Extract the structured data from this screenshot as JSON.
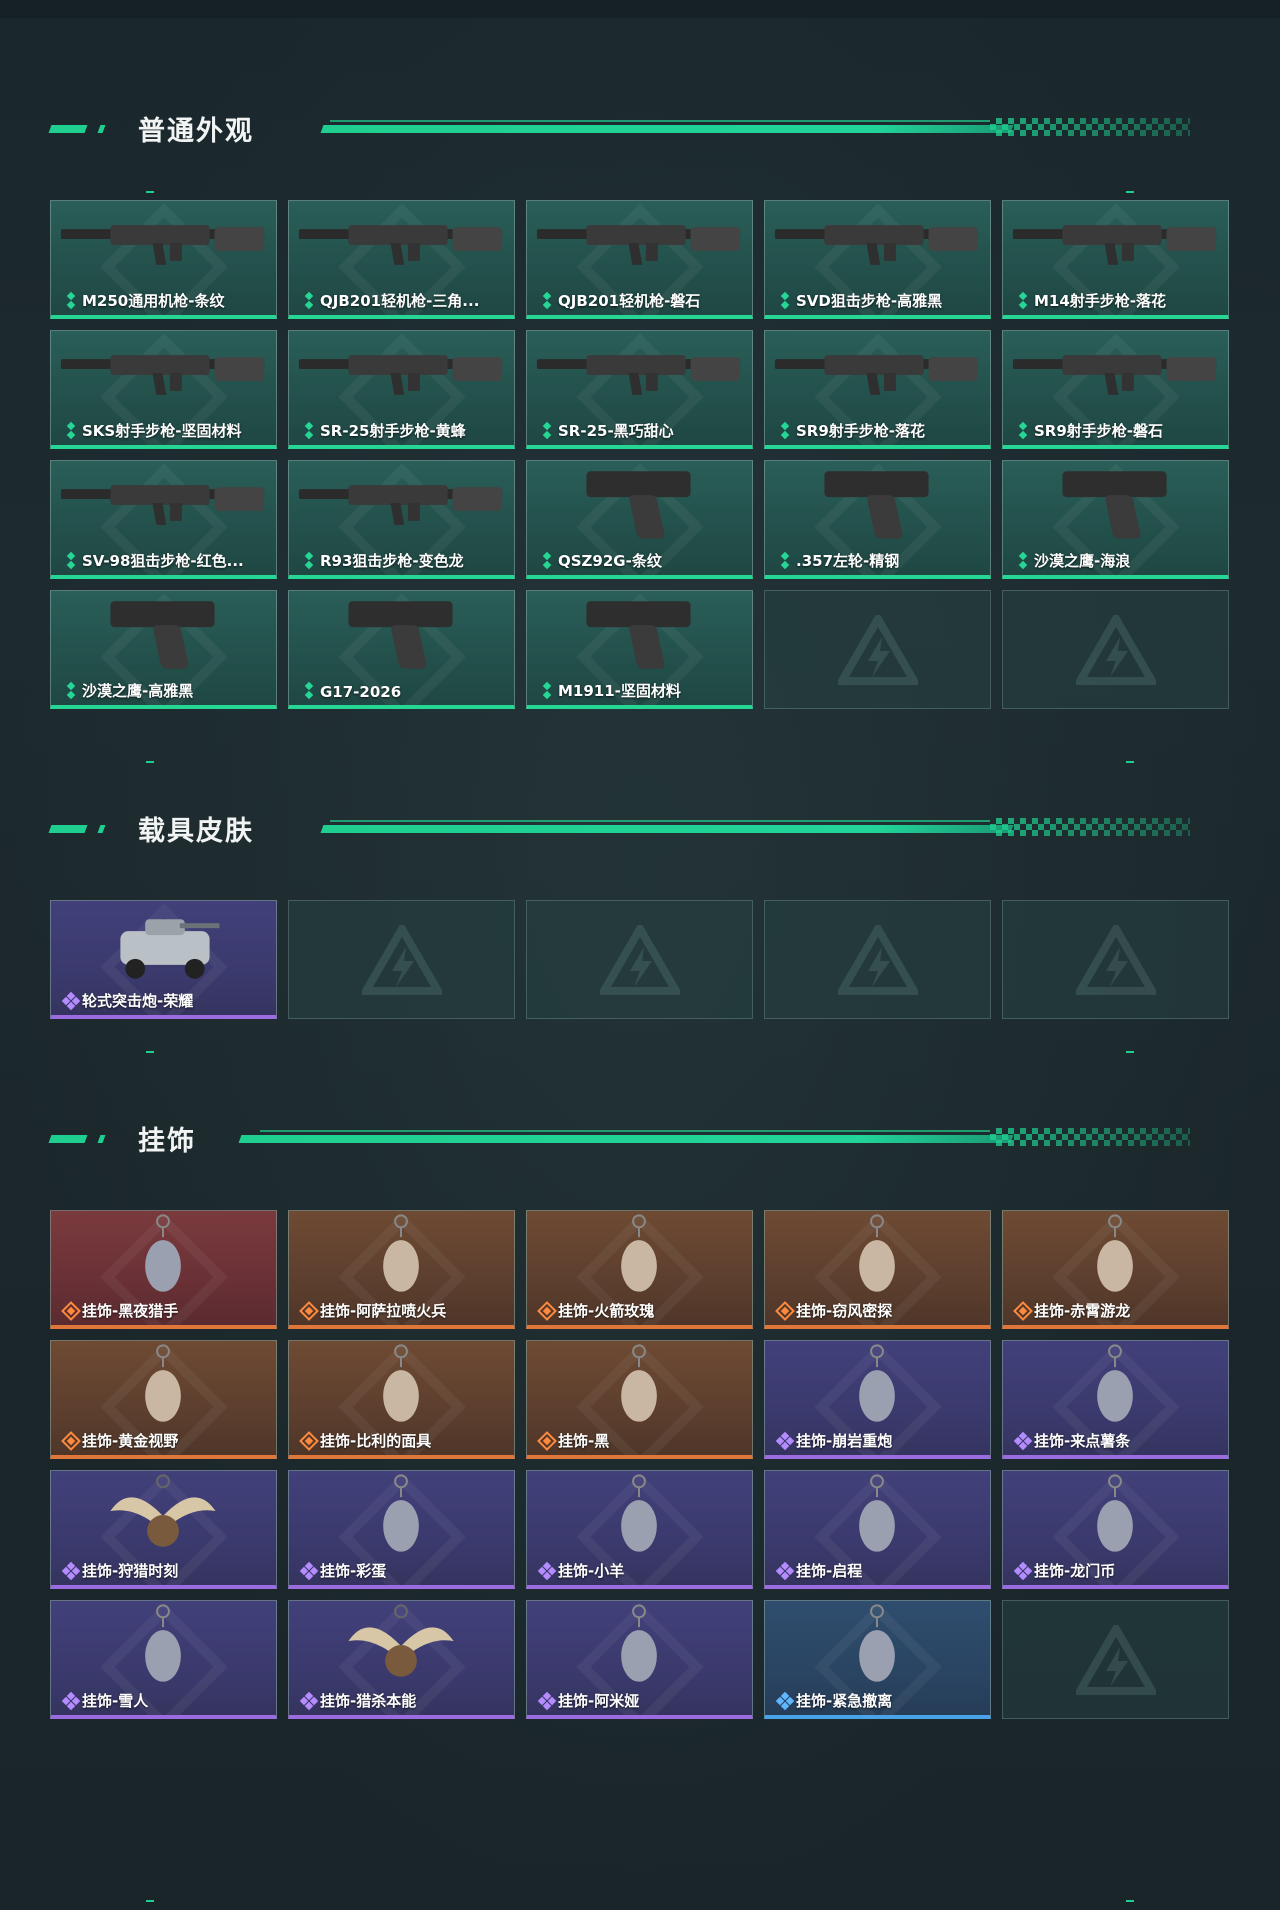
{
  "sections": [
    {
      "title": "普通外观",
      "items": [
        {
          "label": "M250通用机枪-条纹",
          "rarity": "green",
          "icon": "machine-gun-icon"
        },
        {
          "label": "QJB201轻机枪-三角...",
          "rarity": "green",
          "icon": "light-machine-gun-icon"
        },
        {
          "label": "QJB201轻机枪-磐石",
          "rarity": "green",
          "icon": "light-machine-gun-icon"
        },
        {
          "label": "SVD狙击步枪-高雅黑",
          "rarity": "green",
          "icon": "sniper-rifle-icon"
        },
        {
          "label": "M14射手步枪-落花",
          "rarity": "green",
          "icon": "marksman-rifle-icon"
        },
        {
          "label": "SKS射手步枪-坚固材料",
          "rarity": "green",
          "icon": "marksman-rifle-icon"
        },
        {
          "label": "SR-25射手步枪-黄蜂",
          "rarity": "green",
          "icon": "marksman-rifle-icon"
        },
        {
          "label": "SR-25-黑巧甜心",
          "rarity": "green",
          "icon": "marksman-rifle-icon"
        },
        {
          "label": "SR9射手步枪-落花",
          "rarity": "green",
          "icon": "marksman-rifle-icon"
        },
        {
          "label": "SR9射手步枪-磐石",
          "rarity": "green",
          "icon": "marksman-rifle-icon"
        },
        {
          "label": "SV-98狙击步枪-红色...",
          "rarity": "green",
          "icon": "sniper-rifle-icon"
        },
        {
          "label": "R93狙击步枪-变色龙",
          "rarity": "green",
          "icon": "sniper-rifle-icon"
        },
        {
          "label": "QSZ92G-条纹",
          "rarity": "green",
          "icon": "pistol-icon"
        },
        {
          "label": ".357左轮-精钢",
          "rarity": "green",
          "icon": "revolver-icon"
        },
        {
          "label": "沙漠之鹰-海浪",
          "rarity": "green",
          "icon": "pistol-icon"
        },
        {
          "label": "沙漠之鹰-高雅黑",
          "rarity": "green",
          "icon": "pistol-icon"
        },
        {
          "label": "G17-2026",
          "rarity": "green",
          "icon": "pistol-icon"
        },
        {
          "label": "M1911-坚固材料",
          "rarity": "green",
          "icon": "pistol-icon"
        }
      ],
      "empty_slots": 2
    },
    {
      "title": "载具皮肤",
      "items": [
        {
          "label": "轮式突击炮-荣耀",
          "rarity": "purple",
          "icon": "armored-vehicle-icon"
        }
      ],
      "empty_slots": 4
    },
    {
      "title": "挂饰",
      "items": [
        {
          "label": "挂饰-黑夜猎手",
          "rarity": "red",
          "icon": "charm-figure-icon"
        },
        {
          "label": "挂饰-阿萨拉喷火兵",
          "rarity": "orange",
          "icon": "charm-figure-icon"
        },
        {
          "label": "挂饰-火箭玫瑰",
          "rarity": "orange",
          "icon": "charm-figure-icon"
        },
        {
          "label": "挂饰-窃风密探",
          "rarity": "orange",
          "icon": "charm-figure-icon"
        },
        {
          "label": "挂饰-赤霄游龙",
          "rarity": "orange",
          "icon": "charm-figure-icon"
        },
        {
          "label": "挂饰-黄金视野",
          "rarity": "orange",
          "icon": "charm-figure-icon"
        },
        {
          "label": "挂饰-比利的面具",
          "rarity": "orange",
          "icon": "mask-charm-icon"
        },
        {
          "label": "挂饰-黑",
          "rarity": "orange",
          "icon": "tag-charm-icon"
        },
        {
          "label": "挂饰-崩岩重炮",
          "rarity": "purple",
          "icon": "charm-figure-icon"
        },
        {
          "label": "挂饰-来点薯条",
          "rarity": "purple",
          "icon": "fries-charm-icon"
        },
        {
          "label": "挂饰-狩猎时刻",
          "rarity": "purple",
          "icon": "antler-charm-icon"
        },
        {
          "label": "挂饰-彩蛋",
          "rarity": "purple",
          "icon": "egg-charm-icon"
        },
        {
          "label": "挂饰-小羊",
          "rarity": "purple",
          "icon": "sheep-charm-icon"
        },
        {
          "label": "挂饰-启程",
          "rarity": "purple",
          "icon": "medal-charm-icon"
        },
        {
          "label": "挂饰-龙门币",
          "rarity": "purple",
          "icon": "tag-charm-icon"
        },
        {
          "label": "挂饰-雪人",
          "rarity": "purple",
          "icon": "snowman-charm-icon"
        },
        {
          "label": "挂饰-猎杀本能",
          "rarity": "purple",
          "icon": "antler-charm-icon"
        },
        {
          "label": "挂饰-阿米娅",
          "rarity": "purple",
          "icon": "charm-figure-icon"
        },
        {
          "label": "挂饰-紧急撤离",
          "rarity": "blue",
          "icon": "cube-charm-icon"
        }
      ],
      "empty_slots": 1
    }
  ],
  "colors": {
    "accent": "#1fcf8f",
    "green": "#26d695",
    "purple": "#9a6ce0",
    "orange": "#e0773a",
    "blue": "#4aa3e8"
  }
}
